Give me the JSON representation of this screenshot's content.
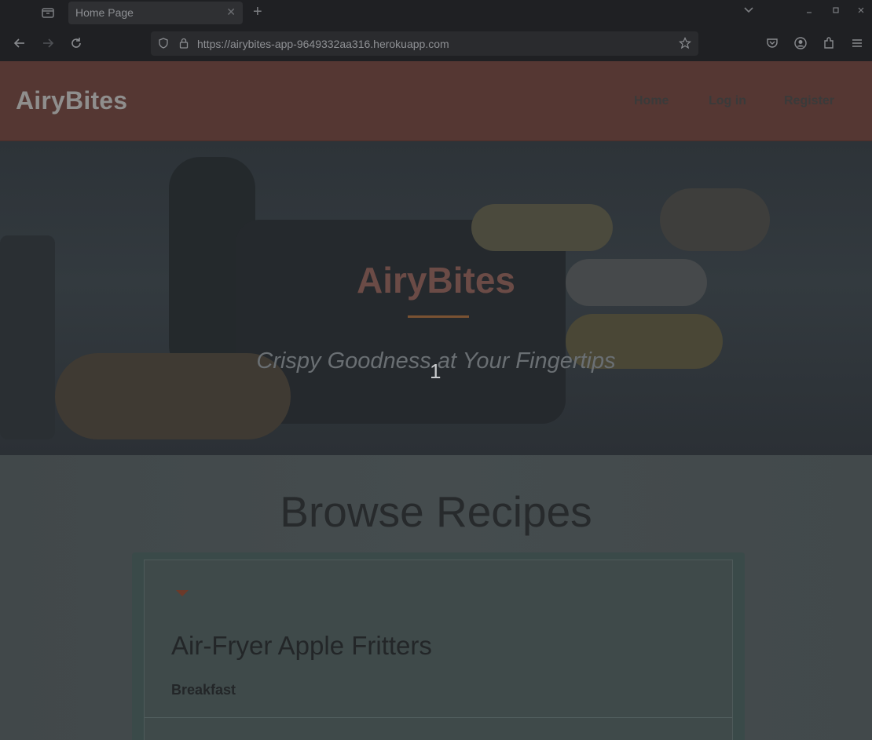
{
  "browser": {
    "tab_title": "Home Page",
    "url": "https://airybites-app-9649332aa316.herokuapp.com"
  },
  "site": {
    "brand": "AiryBites",
    "nav": [
      "Home",
      "Log in",
      "Register"
    ]
  },
  "hero": {
    "title": "AiryBites",
    "tagline": "Crispy Goodness at Your Fingertips",
    "counter": "1"
  },
  "browse": {
    "heading": "Browse Recipes",
    "recipe": {
      "title": "Air-Fryer Apple Fritters",
      "category": "Breakfast"
    }
  },
  "icons": [
    "tab-list-icon",
    "close-icon",
    "plus-icon",
    "chevron-down-icon",
    "minimize-icon",
    "maximize-icon",
    "window-close-icon",
    "back-icon",
    "forward-icon",
    "reload-icon",
    "shield-icon",
    "lock-icon",
    "star-icon",
    "pocket-icon",
    "account-icon",
    "extensions-icon",
    "menu-icon",
    "caret-down-icon"
  ]
}
